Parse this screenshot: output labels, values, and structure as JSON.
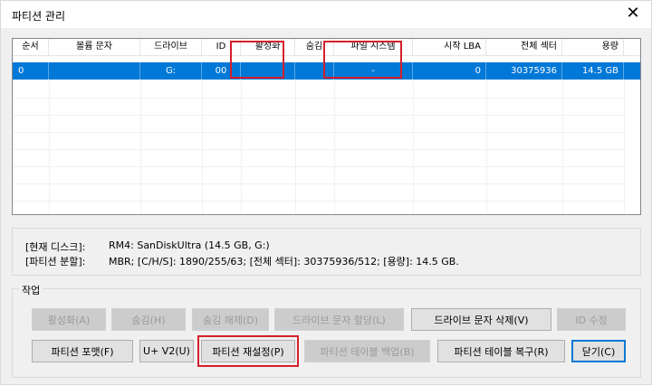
{
  "window": {
    "title": "파티션 관리",
    "close_glyph": "✕"
  },
  "table": {
    "columns": [
      "순서",
      "볼륨 문자",
      "드라이브",
      "ID",
      "활성화",
      "숨김",
      "파일 시스템",
      "시작 LBA",
      "전체 섹터",
      "용량"
    ],
    "rows": [
      [
        "0",
        "",
        "G:",
        "00",
        "",
        "",
        "-",
        "0",
        "30375936",
        "14.5 GB"
      ]
    ],
    "selected_row": 0
  },
  "info": {
    "disk_label": "[현재 디스크]:",
    "disk_value": "RM4: SanDiskUltra (14.5 GB, G:)",
    "partition_label": "[파티션 분할]:",
    "partition_value": "MBR; [C/H/S]: 1890/255/63; [전체 섹터]: 30375936/512; [용량]: 14.5 GB."
  },
  "actions": {
    "title": "작업",
    "row1": [
      {
        "label": "활성화(A)",
        "enabled": false
      },
      {
        "label": "숨김(H)",
        "enabled": false
      },
      {
        "label": "숨김 해제(D)",
        "enabled": false
      },
      {
        "label": "드라이브 문자 할당(L)",
        "enabled": false
      },
      {
        "label": "드라이브 문자 삭제(V)",
        "enabled": true
      },
      {
        "label": "ID 수정",
        "enabled": false
      }
    ],
    "row2": [
      {
        "label": "파티션 포맷(F)",
        "enabled": true
      },
      {
        "label": "U+ V2(U)",
        "enabled": true
      },
      {
        "label": "파티션 재설정(P)",
        "enabled": true
      },
      {
        "label": "파티션 테이블 백업(B)",
        "enabled": false
      },
      {
        "label": "파티션 테이블 복구(R)",
        "enabled": true
      },
      {
        "label": "닫기(C)",
        "enabled": true
      }
    ]
  },
  "colors": {
    "selection": "#0078d7",
    "highlight": "#d51f2a"
  }
}
